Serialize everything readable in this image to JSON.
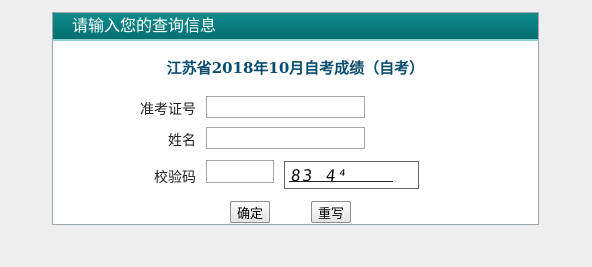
{
  "header": {
    "title": "请输入您的查询信息"
  },
  "exam": {
    "title": "江苏省2018年10月自考成绩（自考）"
  },
  "form": {
    "exam_id_label": "准考证号",
    "exam_id_value": "",
    "name_label": "姓名",
    "name_value": "",
    "captcha_label": "校验码",
    "captcha_value": "",
    "captcha_image_text": "83 4⁴"
  },
  "buttons": {
    "submit_label": "确定",
    "reset_label": "重写"
  },
  "colors": {
    "header_bg": "#0a7d80",
    "title_text": "#0b4d6e",
    "page_bg": "#eeeeee"
  }
}
